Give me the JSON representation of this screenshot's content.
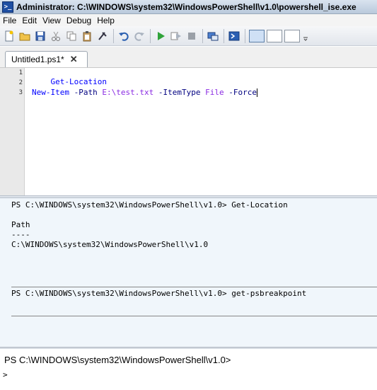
{
  "window": {
    "title": "Administrator: C:\\WINDOWS\\system32\\WindowsPowerShell\\v1.0\\powershell_ise.exe",
    "icon": "powershell-icon"
  },
  "menu": {
    "items": [
      "File",
      "Edit",
      "View",
      "Debug",
      "Help"
    ]
  },
  "toolbar": {
    "icons": [
      "new-file-icon",
      "open-folder-icon",
      "save-icon",
      "cut-icon",
      "copy-icon",
      "paste-icon",
      "clear-icon",
      "undo-icon",
      "redo-icon",
      "run-icon",
      "run-selection-icon",
      "stop-icon",
      "new-remote-tab-icon",
      "start-powershell-icon",
      "layout-top-icon",
      "layout-right-icon",
      "layout-maximize-icon",
      "toolbar-overflow-icon"
    ]
  },
  "tabs": [
    {
      "label": "Untitled1.ps1*",
      "close": "✕"
    }
  ],
  "editor": {
    "line_numbers": [
      "1",
      "2",
      "3"
    ],
    "lines": {
      "l1_cmd": "Get-Location",
      "l3_cmd": "New-Item",
      "l3_p1": "-Path",
      "l3_a1": "E:\\test.txt",
      "l3_p2": "-ItemType",
      "l3_a2": "File",
      "l3_p3": "-Force"
    }
  },
  "output": {
    "prompt1": "PS C:\\WINDOWS\\system32\\WindowsPowerShell\\v1.0> Get-Location",
    "header": "Path",
    "underline": "----",
    "path": "C:\\WINDOWS\\system32\\WindowsPowerShell\\v1.0",
    "prompt2": "PS C:\\WINDOWS\\system32\\WindowsPowerShell\\v1.0> get-psbreakpoint"
  },
  "command_pane": {
    "prompt": "PS C:\\WINDOWS\\system32\\WindowsPowerShell\\v1.0>",
    "chevron": ">"
  }
}
